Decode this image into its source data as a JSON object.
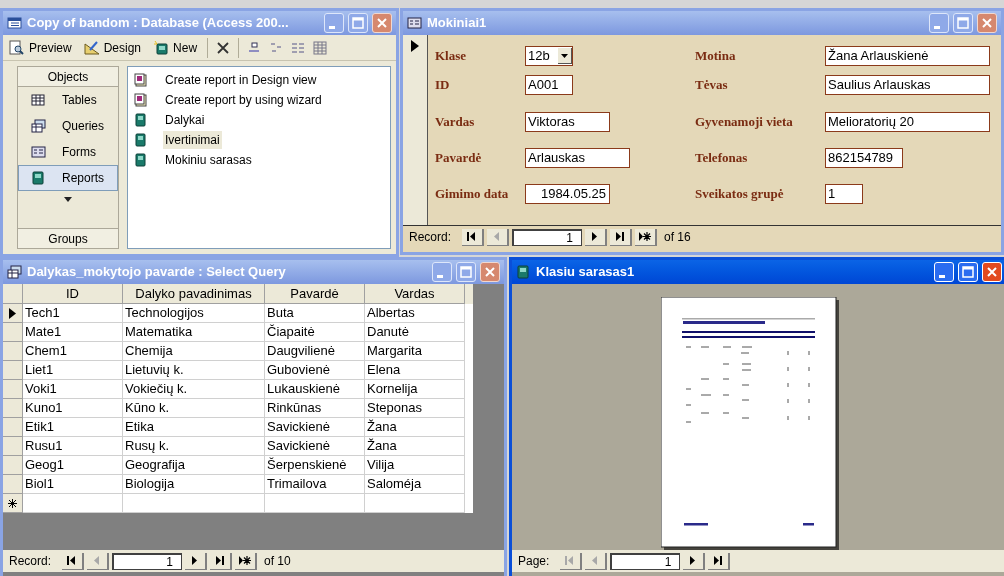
{
  "database_window": {
    "title": "Copy of bandom : Database (Access 200...",
    "toolbar": [
      {
        "kind": "preview",
        "label": "Preview"
      },
      {
        "kind": "design",
        "label": "Design"
      },
      {
        "kind": "new",
        "label": "New"
      }
    ],
    "objects_header": "Objects",
    "objects": [
      {
        "kind": "tables",
        "label": "Tables",
        "selected": false
      },
      {
        "kind": "queries",
        "label": "Queries",
        "selected": false
      },
      {
        "kind": "forms",
        "label": "Forms",
        "selected": false
      },
      {
        "kind": "reports",
        "label": "Reports",
        "selected": true
      }
    ],
    "groups_header": "Groups",
    "items": [
      {
        "kind": "wizard",
        "label": "Create report in Design view",
        "selected": false
      },
      {
        "kind": "wizard",
        "label": "Create report by using wizard",
        "selected": false
      },
      {
        "kind": "report",
        "label": "Dalykai",
        "selected": false
      },
      {
        "kind": "report",
        "label": "Ivertinimai",
        "selected": true
      },
      {
        "kind": "report",
        "label": "Mokiniu sarasas",
        "selected": false
      }
    ]
  },
  "form_window": {
    "title": "Mokiniai1",
    "left_fields": [
      {
        "kind": "combo",
        "label": "Klase",
        "value": "12b"
      },
      {
        "kind": "text",
        "label": "ID",
        "value": "A001"
      },
      {
        "kind": "text",
        "label": "Vardas",
        "value": "Viktoras"
      },
      {
        "kind": "text",
        "label": "Pavardė",
        "value": "Arlauskas"
      },
      {
        "kind": "date",
        "label": "Gimimo data",
        "value": "1984.05.25"
      }
    ],
    "right_fields": [
      {
        "kind": "text",
        "label": "Motina",
        "value": "Žana Arlauskienė"
      },
      {
        "kind": "text",
        "label": "Tėvas",
        "value": "Saulius Arlauskas"
      },
      {
        "kind": "text",
        "label": "Gyvenamoji vieta",
        "value": "Melioratorių 20"
      },
      {
        "kind": "text",
        "label": "Telefonas",
        "value": "862154789"
      },
      {
        "kind": "text",
        "label": "Sveikatos grupė",
        "value": "1"
      }
    ],
    "record_nav": {
      "label": "Record:",
      "current": "1",
      "total": "of 16",
      "buttons": [
        {
          "kind": "first",
          "disabled": false
        },
        {
          "kind": "prev",
          "disabled": true
        },
        {
          "kind": "next",
          "disabled": false
        },
        {
          "kind": "last",
          "disabled": false
        },
        {
          "kind": "new",
          "disabled": false
        }
      ]
    }
  },
  "query_window": {
    "title": "Dalykas_mokytojo pavarde : Select Query",
    "columns": [
      "ID",
      "Dalyko pavadinimas",
      "Pavardė",
      "Vardas"
    ],
    "rows": [
      {
        "cells": [
          "Tech1",
          "Technologijos",
          "Buta",
          "Albertas"
        ],
        "selected": true
      },
      {
        "cells": [
          "Mate1",
          "Matematika",
          "Čiapaitė",
          "Danutė"
        ],
        "selected": false
      },
      {
        "cells": [
          "Chem1",
          "Chemija",
          "Daugvilienė",
          "Margarita"
        ],
        "selected": false
      },
      {
        "cells": [
          "Liet1",
          "Lietuvių k.",
          "Gubovienė",
          "Elena"
        ],
        "selected": false
      },
      {
        "cells": [
          "Voki1",
          "Vokiečių k.",
          "Lukauskienė",
          "Kornelija"
        ],
        "selected": false
      },
      {
        "cells": [
          "Kuno1",
          "Kūno k.",
          "Rinkūnas",
          "Steponas"
        ],
        "selected": false
      },
      {
        "cells": [
          "Etik1",
          "Etika",
          "Savickienė",
          "Žana"
        ],
        "selected": false
      },
      {
        "cells": [
          "Rusu1",
          "Rusų k.",
          "Savickienė",
          "Žana"
        ],
        "selected": false
      },
      {
        "cells": [
          "Geog1",
          "Geografija",
          "Šerpenskienė",
          "Vilija"
        ],
        "selected": false
      },
      {
        "cells": [
          "Biol1",
          "Biologija",
          "Trimailova",
          "Saloméja"
        ],
        "selected": false
      }
    ],
    "record_nav": {
      "label": "Record:",
      "current": "1",
      "total": "of 10",
      "buttons": [
        {
          "kind": "first",
          "disabled": false
        },
        {
          "kind": "prev",
          "disabled": true
        },
        {
          "kind": "next",
          "disabled": false
        },
        {
          "kind": "last",
          "disabled": false
        },
        {
          "kind": "new",
          "disabled": false
        }
      ]
    }
  },
  "report_window": {
    "title": "Klasiu sarasas1",
    "page_nav": {
      "label": "Page:",
      "current": "1",
      "buttons": [
        {
          "kind": "first",
          "disabled": true
        },
        {
          "kind": "prev",
          "disabled": true
        },
        {
          "kind": "next",
          "disabled": false
        },
        {
          "kind": "last",
          "disabled": false
        }
      ]
    }
  }
}
